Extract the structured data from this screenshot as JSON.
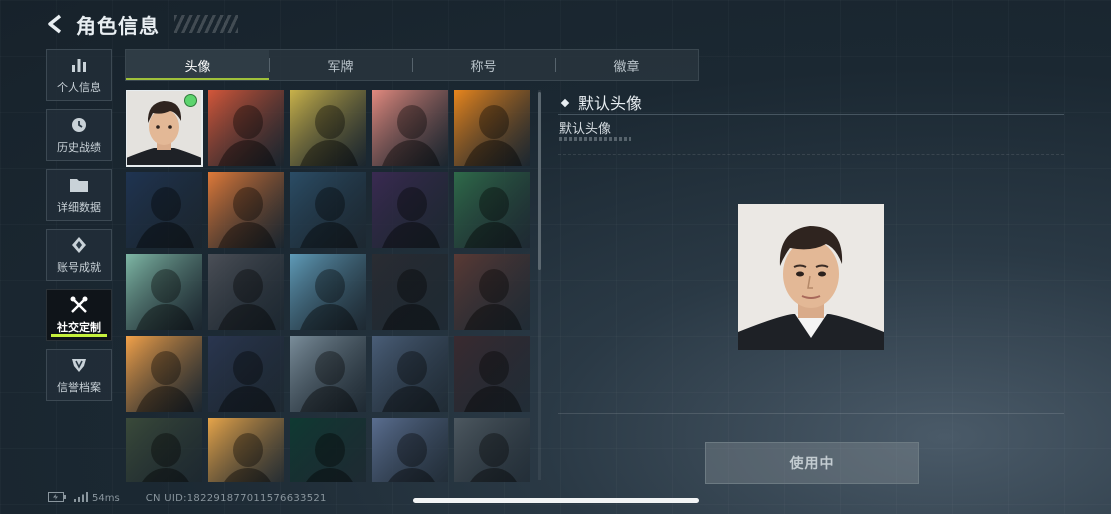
{
  "header": {
    "title": "角色信息",
    "back_icon": "chevron-left-icon"
  },
  "sidebar": {
    "items": [
      {
        "label": "个人信息",
        "icon": "bar-chart-icon",
        "active": false
      },
      {
        "label": "历史战绩",
        "icon": "history-clock-icon",
        "active": false
      },
      {
        "label": "详细数据",
        "icon": "folder-icon",
        "active": false
      },
      {
        "label": "账号成就",
        "icon": "achievement-icon",
        "active": false
      },
      {
        "label": "社交定制",
        "icon": "tools-icon",
        "active": true
      },
      {
        "label": "信誉档案",
        "icon": "shield-badge-icon",
        "active": false
      }
    ]
  },
  "tabs": [
    {
      "label": "头像",
      "active": true
    },
    {
      "label": "军牌",
      "active": false
    },
    {
      "label": "称号",
      "active": false
    },
    {
      "label": "徽章",
      "active": false
    }
  ],
  "avatars": [
    {
      "name": "portrait-photo-avatar",
      "selected": true,
      "bg": "#e4e2de"
    },
    {
      "name": "soldier-headset-avatar",
      "bg": "#d4573a"
    },
    {
      "name": "bald-operator-avatar",
      "bg": "#c9b24a"
    },
    {
      "name": "helmet-soldier-avatar",
      "bg": "#e38a7f"
    },
    {
      "name": "masked-operator-avatar",
      "bg": "#e9861d"
    },
    {
      "name": "night-soldier-avatar",
      "bg": "#1f3452"
    },
    {
      "name": "heavy-soldier-avatar",
      "bg": "#e07a39"
    },
    {
      "name": "sniper-scope-avatar",
      "bg": "#2b4d66"
    },
    {
      "name": "documents-avatar",
      "bg": "#3a2a52"
    },
    {
      "name": "exit-door-avatar",
      "bg": "#2f6b4a"
    },
    {
      "name": "way-out-sign-avatar",
      "bg": "#7fb8a6"
    },
    {
      "name": "crystal-hand-avatar",
      "bg": "#4b4f57"
    },
    {
      "name": "villa-avatar",
      "bg": "#5f9bb8"
    },
    {
      "name": "feather-avatar",
      "bg": "#2a2c32"
    },
    {
      "name": "scales-crest-avatar",
      "bg": "#5a3a35"
    },
    {
      "name": "flame-cartoon-avatar",
      "bg": "#f3a24a"
    },
    {
      "name": "lightning-man-avatar",
      "bg": "#2a3650"
    },
    {
      "name": "cliff-explorer-avatar",
      "bg": "#7a8d9a"
    },
    {
      "name": "archer-girl-avatar",
      "bg": "#4a5e78"
    },
    {
      "name": "goggles-girl-avatar",
      "bg": "#3a2a30"
    },
    {
      "name": "alligator-sign-avatar",
      "bg": "#3a4a3a"
    },
    {
      "name": "cartoon-bear-avatar",
      "bg": "#e7a54a"
    },
    {
      "name": "w-logo-avatar",
      "bg": "#0f3a32"
    },
    {
      "name": "anime-duo-avatar",
      "bg": "#5a6e90"
    },
    {
      "name": "masked-agent-avatar",
      "bg": "#4d5860"
    }
  ],
  "detail": {
    "title": "默认头像",
    "description": "默认头像",
    "use_button": "使用中"
  },
  "footer": {
    "ping": "54ms",
    "uid": "CN UID:182291877011576633521"
  },
  "colors": {
    "accent": "#c5f03c",
    "tab_underline": "#9fc13a",
    "online_dot": "#5dd46e"
  }
}
